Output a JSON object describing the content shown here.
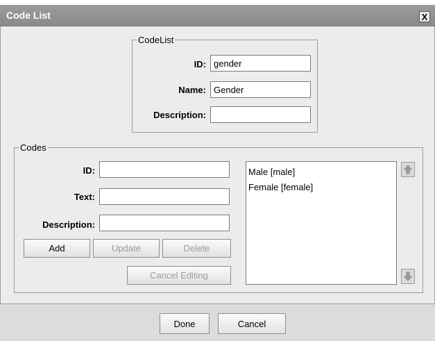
{
  "window": {
    "title": "Code List",
    "close_glyph": "X"
  },
  "codelist": {
    "legend": "CodeList",
    "id_label": "ID:",
    "id_value": "gender",
    "name_label": "Name:",
    "name_value": "Gender",
    "description_label": "Description:",
    "description_value": ""
  },
  "codes": {
    "legend": "Codes",
    "id_label": "ID:",
    "id_value": "",
    "text_label": "Text:",
    "text_value": "",
    "description_label": "Description:",
    "description_value": "",
    "add_label": "Add",
    "update_label": "Update",
    "delete_label": "Delete",
    "cancel_editing_label": "Cancel Editing",
    "list": [
      "Male [male]",
      "Female [female]"
    ],
    "move_up_icon": "arrow-up-icon",
    "move_down_icon": "arrow-down-icon"
  },
  "footer": {
    "done_label": "Done",
    "cancel_label": "Cancel"
  }
}
